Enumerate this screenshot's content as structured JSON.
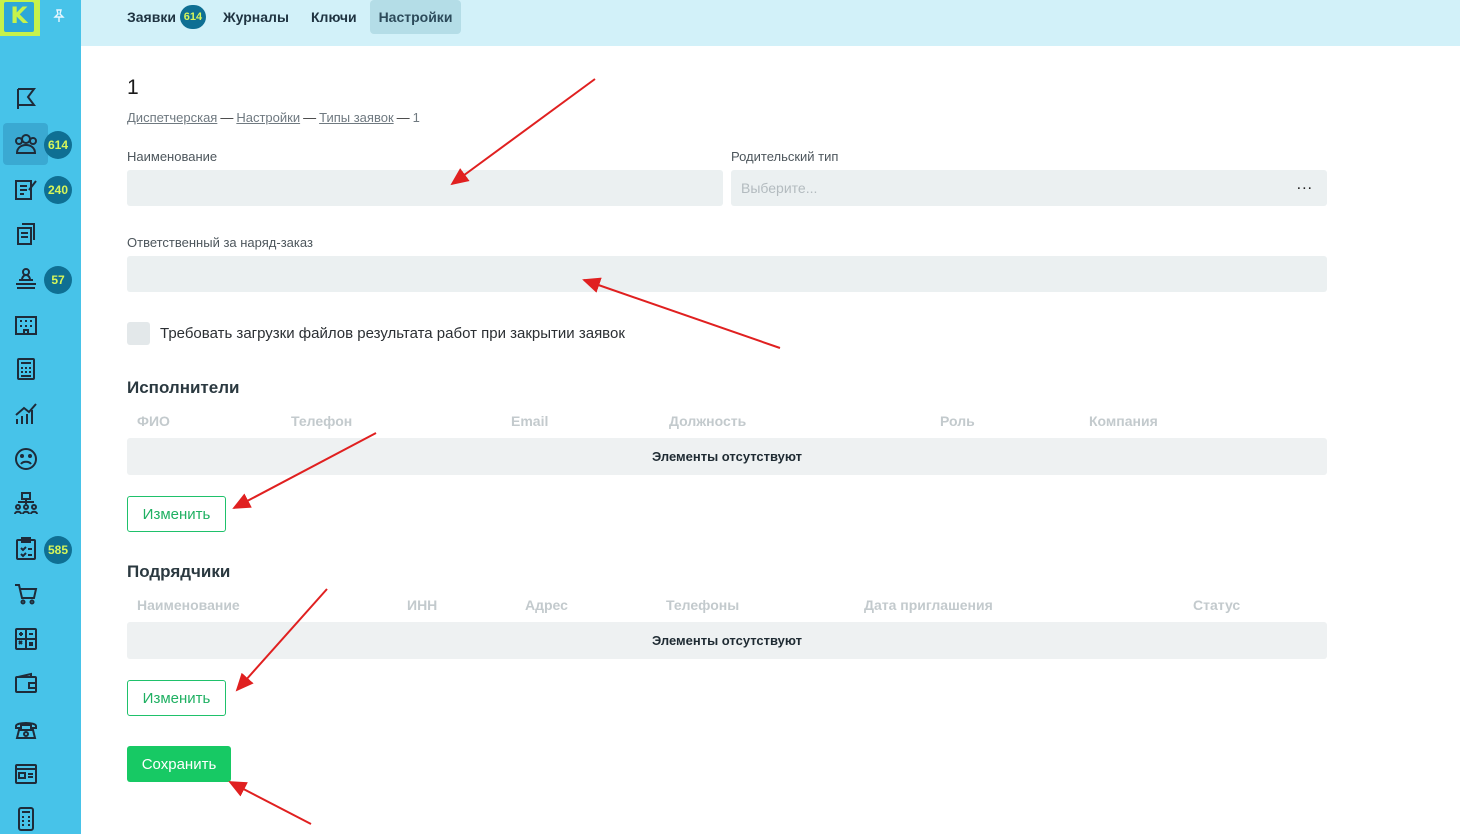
{
  "logo": {
    "letter": "K"
  },
  "sidebar": {
    "badges": {
      "requests": "614",
      "journals": "240",
      "reception": "57",
      "tasks": "585"
    }
  },
  "tabs": [
    {
      "label": "Заявки",
      "badge": "614"
    },
    {
      "label": "Журналы"
    },
    {
      "label": "Ключи"
    },
    {
      "label": "Настройки"
    }
  ],
  "page": {
    "title": "1",
    "breadcrumb": [
      "Диспетчерская",
      "Настройки",
      "Типы заявок",
      "1"
    ]
  },
  "form": {
    "name_label": "Наименование",
    "name_value": "",
    "parent_label": "Родительский тип",
    "parent_placeholder": "Выберите...",
    "parent_menu": "...",
    "responsible_label": "Ответственный за наряд-заказ",
    "responsible_value": "",
    "require_files_label": "Требовать загрузки файлов результата работ при закрытии заявок"
  },
  "executors": {
    "title": "Исполнители",
    "columns": [
      "ФИО",
      "Телефон",
      "Email",
      "Должность",
      "Роль",
      "Компания"
    ],
    "empty_text": "Элементы отсутствуют",
    "edit_label": "Изменить"
  },
  "contractors": {
    "title": "Подрядчики",
    "columns": [
      "Наименование",
      "ИНН",
      "Адрес",
      "Телефоны",
      "Дата приглашения",
      "Статус"
    ],
    "empty_text": "Элементы отсутствуют",
    "edit_label": "Изменить"
  },
  "save_label": "Сохранить",
  "colors": {
    "sidebar": "#47c3e9",
    "accent": "#17c964",
    "badge": "#0f6f93",
    "arrow": "#e02020"
  }
}
